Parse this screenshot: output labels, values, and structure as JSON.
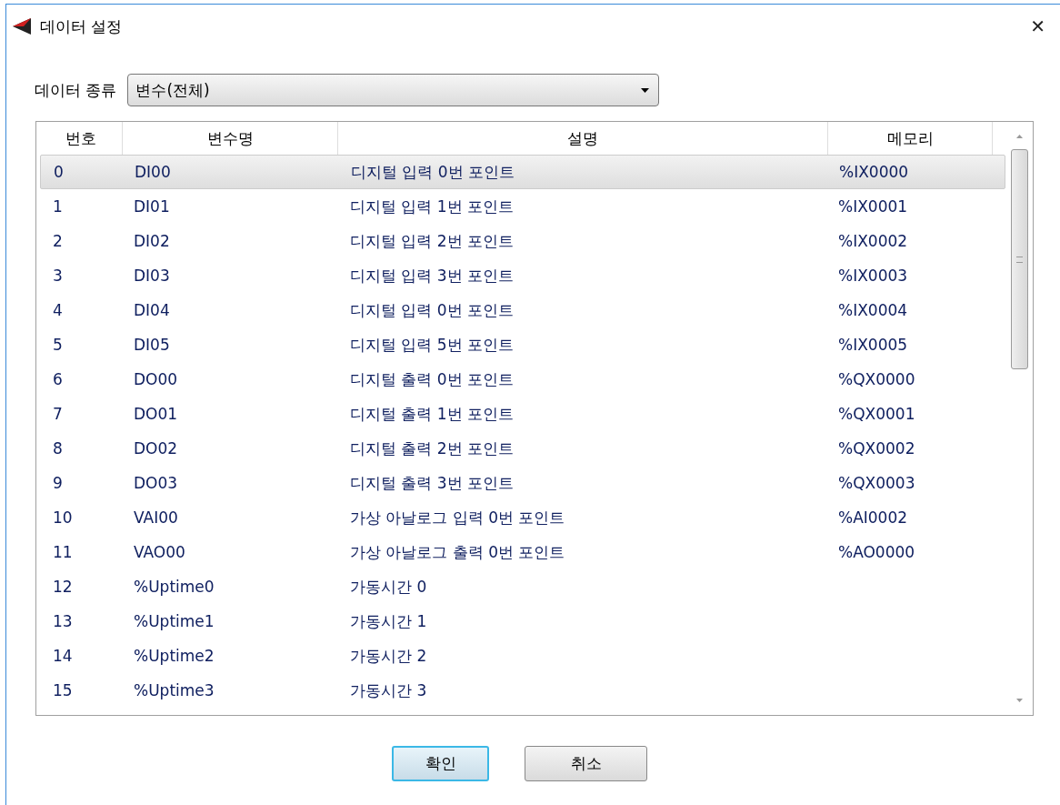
{
  "window": {
    "title": "데이터 설정",
    "close": "✕"
  },
  "data_type": {
    "label": "데이터 종류",
    "value": "변수(전체)"
  },
  "table": {
    "columns": [
      "번호",
      "변수명",
      "설명",
      "메모리"
    ],
    "rows": [
      {
        "cells": [
          "0",
          "DI00",
          "디지털 입력 0번 포인트",
          "%IX0000"
        ],
        "selected": true
      },
      {
        "cells": [
          "1",
          "DI01",
          "디지털 입력 1번 포인트",
          "%IX0001"
        ],
        "selected": false
      },
      {
        "cells": [
          "2",
          "DI02",
          "디지털 입력 2번 포인트",
          "%IX0002"
        ],
        "selected": false
      },
      {
        "cells": [
          "3",
          "DI03",
          "디지털 입력 3번 포인트",
          "%IX0003"
        ],
        "selected": false
      },
      {
        "cells": [
          "4",
          "DI04",
          "디지털 입력 0번 포인트",
          "%IX0004"
        ],
        "selected": false
      },
      {
        "cells": [
          "5",
          "DI05",
          "디지털 입력 5번 포인트",
          "%IX0005"
        ],
        "selected": false
      },
      {
        "cells": [
          "6",
          "DO00",
          "디지털 출력 0번 포인트",
          "%QX0000"
        ],
        "selected": false
      },
      {
        "cells": [
          "7",
          "DO01",
          "디지털 출력 1번 포인트",
          "%QX0001"
        ],
        "selected": false
      },
      {
        "cells": [
          "8",
          "DO02",
          "디지털 출력 2번 포인트",
          "%QX0002"
        ],
        "selected": false
      },
      {
        "cells": [
          "9",
          "DO03",
          "디지털 출력 3번 포인트",
          "%QX0003"
        ],
        "selected": false
      },
      {
        "cells": [
          "10",
          "VAI00",
          "가상 아날로그 입력 0번 포인트",
          "%AI0002"
        ],
        "selected": false
      },
      {
        "cells": [
          "11",
          "VAO00",
          "가상 아날로그 출력 0번 포인트",
          "%AO0000"
        ],
        "selected": false
      },
      {
        "cells": [
          "12",
          "%Uptime0",
          "가동시간 0",
          ""
        ],
        "selected": false
      },
      {
        "cells": [
          "13",
          "%Uptime1",
          "가동시간 1",
          ""
        ],
        "selected": false
      },
      {
        "cells": [
          "14",
          "%Uptime2",
          "가동시간 2",
          ""
        ],
        "selected": false
      },
      {
        "cells": [
          "15",
          "%Uptime3",
          "가동시간 3",
          ""
        ],
        "selected": false
      }
    ]
  },
  "buttons": [
    {
      "label": "확인",
      "default": true
    },
    {
      "label": "취소",
      "default": false
    }
  ]
}
